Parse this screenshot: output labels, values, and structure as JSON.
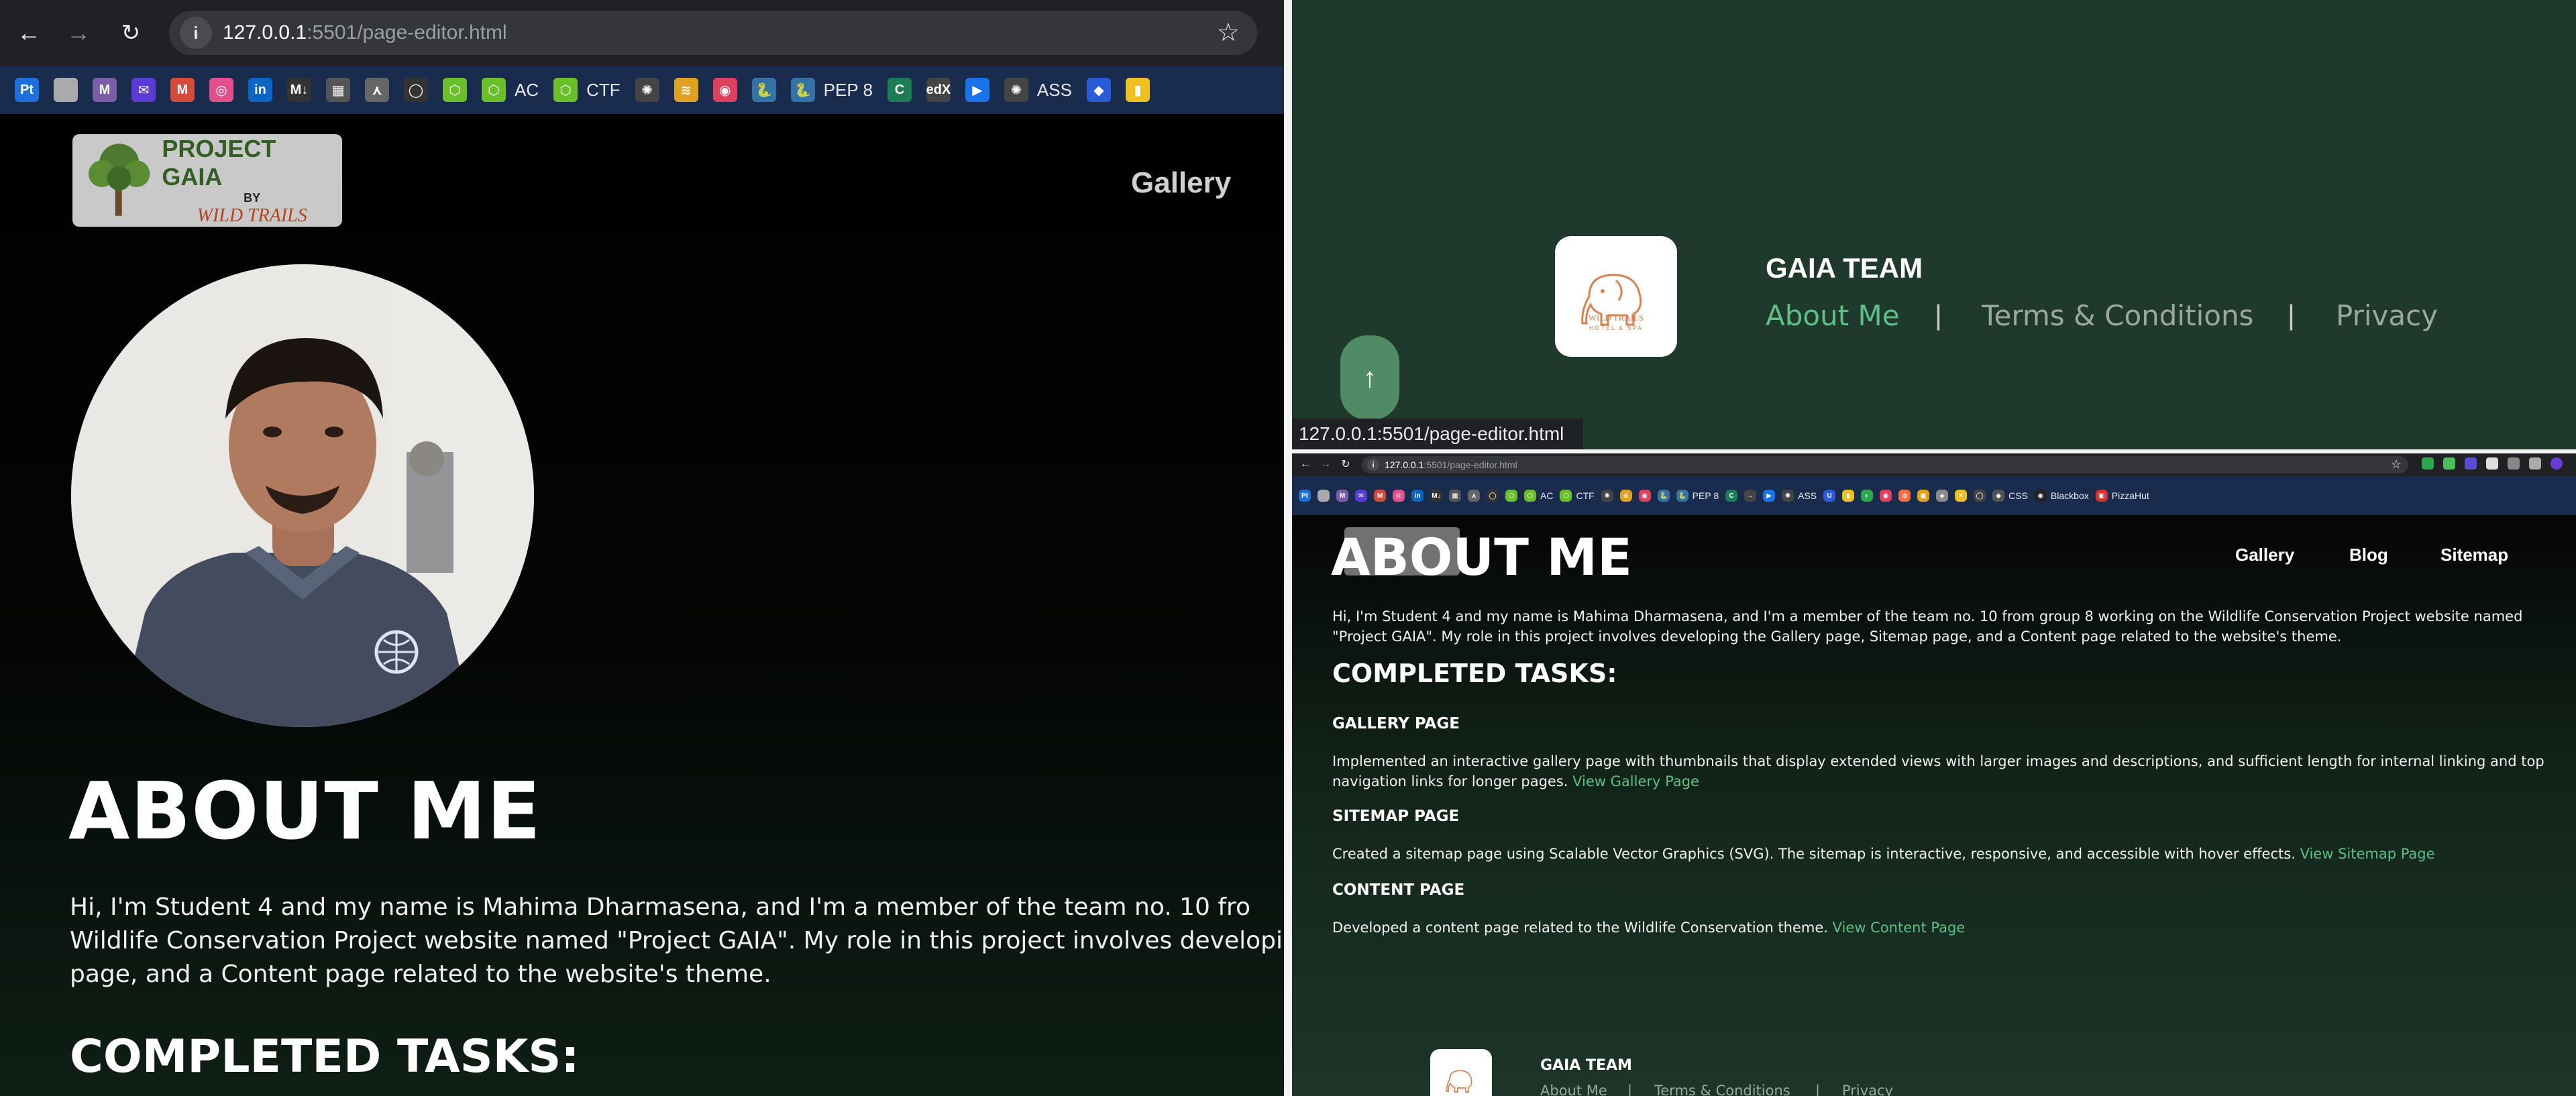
{
  "left": {
    "url_host": "127.0.0.1",
    "url_path": ":5501/page-editor.html",
    "bookmarks": [
      {
        "icon": "Pt",
        "label": "",
        "color": "#1e6fd9"
      },
      {
        "icon": "",
        "label": "",
        "color": "#aaaaaa"
      },
      {
        "icon": "M",
        "label": "",
        "color": "#7b5ea7"
      },
      {
        "icon": "✉",
        "label": "",
        "color": "#5b3bd6"
      },
      {
        "icon": "M",
        "label": "",
        "color": "#d64a3b"
      },
      {
        "icon": "◎",
        "label": "",
        "color": "#e0508c"
      },
      {
        "icon": "in",
        "label": "",
        "color": "#0a66c2"
      },
      {
        "icon": "M↓",
        "label": "",
        "color": "#333333"
      },
      {
        "icon": "▦",
        "label": "",
        "color": "#555555"
      },
      {
        "icon": "⋏",
        "label": "",
        "color": "#666666"
      },
      {
        "icon": "◯",
        "label": "",
        "color": "#333333"
      },
      {
        "icon": "⬡",
        "label": "",
        "color": "#6bbf2a"
      },
      {
        "icon": "⬡",
        "label": "AC",
        "color": "#6bbf2a"
      },
      {
        "icon": "⬡",
        "label": "CTF",
        "color": "#6bbf2a"
      },
      {
        "icon": "✺",
        "label": "",
        "color": "#444444"
      },
      {
        "icon": "≋",
        "label": "",
        "color": "#e0a020"
      },
      {
        "icon": "◉",
        "label": "",
        "color": "#e04060"
      },
      {
        "icon": "🐍",
        "label": "",
        "color": "#3572a5"
      },
      {
        "icon": "🐍",
        "label": "PEP 8",
        "color": "#3572a5"
      },
      {
        "icon": "C",
        "label": "",
        "color": "#1c7c54"
      },
      {
        "icon": "edX",
        "label": "",
        "color": "#444444"
      },
      {
        "icon": "▶",
        "label": "",
        "color": "#1a73e8"
      },
      {
        "icon": "✺",
        "label": "ASS",
        "color": "#444444"
      },
      {
        "icon": "◆",
        "label": "",
        "color": "#2a5bd7"
      },
      {
        "icon": "▮",
        "label": "",
        "color": "#f0c020"
      }
    ],
    "logo": {
      "title": "PROJECT GAIA",
      "by": "BY",
      "sub": "WILD TRAILS"
    },
    "nav_gallery": "Gallery",
    "heading": "ABOUT ME",
    "intro_lines": [
      "Hi, I'm Student 4 and my name is Mahima Dharmasena, and I'm a member of the team no. 10 fro",
      "Wildlife Conservation Project website named \"Project GAIA\". My role in this project involves developing",
      "page, and a Content page related to the website's theme."
    ],
    "completed": "COMPLETED TASKS:"
  },
  "right_top": {
    "team_title": "GAIA TEAM",
    "links": [
      "About Me",
      "Terms & Conditions",
      "Privacy"
    ],
    "sep": "|",
    "scroll_arrow": "↑",
    "status_url": "127.0.0.1:5501/page-editor.html",
    "logo_title": "WILD TRAILS",
    "logo_sub": "HOTEL & SPA"
  },
  "right_bottom": {
    "url_host": "127.0.0.1",
    "url_path": ":5501/page-editor.html",
    "bookmarks": [
      {
        "icon": "Pt",
        "label": "",
        "color": "#1e6fd9"
      },
      {
        "icon": "",
        "label": "",
        "color": "#aaaaaa"
      },
      {
        "icon": "M",
        "label": "",
        "color": "#7b5ea7"
      },
      {
        "icon": "✉",
        "label": "",
        "color": "#5b3bd6"
      },
      {
        "icon": "M",
        "label": "",
        "color": "#d64a3b"
      },
      {
        "icon": "◎",
        "label": "",
        "color": "#e0508c"
      },
      {
        "icon": "in",
        "label": "",
        "color": "#0a66c2"
      },
      {
        "icon": "M↓",
        "label": "",
        "color": "#333333"
      },
      {
        "icon": "▦",
        "label": "",
        "color": "#555555"
      },
      {
        "icon": "⋏",
        "label": "",
        "color": "#666666"
      },
      {
        "icon": "◯",
        "label": "",
        "color": "#333333"
      },
      {
        "icon": "⬡",
        "label": "",
        "color": "#6bbf2a"
      },
      {
        "icon": "⬡",
        "label": "AC",
        "color": "#6bbf2a"
      },
      {
        "icon": "⬡",
        "label": "CTF",
        "color": "#6bbf2a"
      },
      {
        "icon": "✺",
        "label": "",
        "color": "#444444"
      },
      {
        "icon": "≋",
        "label": "",
        "color": "#e0a020"
      },
      {
        "icon": "◉",
        "label": "",
        "color": "#e04060"
      },
      {
        "icon": "🐍",
        "label": "",
        "color": "#3572a5"
      },
      {
        "icon": "🐍",
        "label": "PEP 8",
        "color": "#3572a5"
      },
      {
        "icon": "C",
        "label": "",
        "color": "#1c7c54"
      },
      {
        "icon": "→",
        "label": "",
        "color": "#444444"
      },
      {
        "icon": "▶",
        "label": "",
        "color": "#1a73e8"
      },
      {
        "icon": "✺",
        "label": "ASS",
        "color": "#444444"
      },
      {
        "icon": "U",
        "label": "",
        "color": "#2a5bd7"
      },
      {
        "icon": "▮",
        "label": "",
        "color": "#f0c020"
      },
      {
        "icon": "◐",
        "label": "",
        "color": "#2aa84a"
      },
      {
        "icon": "◉",
        "label": "",
        "color": "#e04060"
      },
      {
        "icon": "◍",
        "label": "",
        "color": "#ff6a3d"
      },
      {
        "icon": "▣",
        "label": "",
        "color": "#e0a020"
      },
      {
        "icon": "◈",
        "label": "",
        "color": "#888888"
      },
      {
        "icon": "✕",
        "label": "",
        "color": "#f0c020"
      },
      {
        "icon": "◯",
        "label": "",
        "color": "#444444"
      },
      {
        "icon": "◆",
        "label": "CSS",
        "color": "#555555"
      },
      {
        "icon": "◉",
        "label": "Blackbox",
        "color": "#222222"
      },
      {
        "icon": "▣",
        "label": "PizzaHut",
        "color": "#d62f2f"
      }
    ],
    "heading": "ABOUT ME",
    "nav": [
      "Gallery",
      "Blog",
      "Sitemap"
    ],
    "intro": "Hi, I'm Student 4 and my name is Mahima Dharmasena, and I'm a member of the team no. 10 from group 8 working on the Wildlife Conservation Project website named \"Project GAIA\". My role in this project involves developing the Gallery page, Sitemap page, and a Content page related to the website's theme.",
    "completed": "COMPLETED TASKS:",
    "tasks": [
      {
        "title": "GALLERY PAGE",
        "text": "Implemented an interactive gallery page with thumbnails that display extended views with larger images and descriptions, and sufficient length for internal linking and top navigation links for longer pages.",
        "link": "View Gallery Page"
      },
      {
        "title": "SITEMAP PAGE",
        "text": "Created a sitemap page using Scalable Vector Graphics (SVG). The sitemap is interactive, responsive, and accessible with hover effects.",
        "link": "View Sitemap Page"
      },
      {
        "title": "CONTENT PAGE",
        "text": "Developed a content page related to the Wildlife Conservation theme.",
        "link": "View Content Page"
      }
    ],
    "footer_title": "GAIA TEAM",
    "footer_links": [
      "About Me",
      "Terms & Conditions",
      "Privacy"
    ],
    "sep": "|"
  }
}
